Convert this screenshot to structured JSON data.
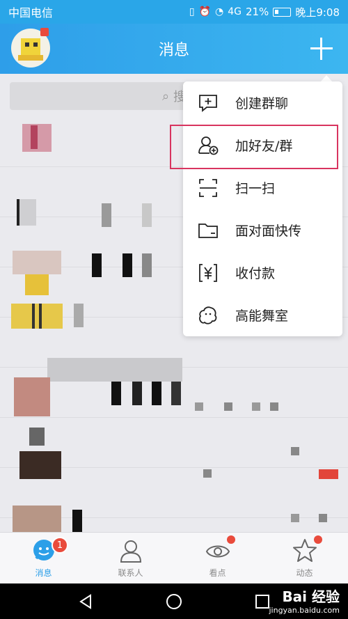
{
  "status_bar": {
    "carrier": "中国电信",
    "signal": "4G",
    "battery": "21%",
    "time": "晚上9:08"
  },
  "header": {
    "title": "消息"
  },
  "search": {
    "placeholder": "搜"
  },
  "menu": {
    "items": [
      {
        "label": "创建群聊",
        "icon": "create-group-chat-icon"
      },
      {
        "label": "加好友/群",
        "icon": "add-friend-icon",
        "highlighted": true
      },
      {
        "label": "扫一扫",
        "icon": "scan-icon"
      },
      {
        "label": "面对面快传",
        "icon": "folder-transfer-icon"
      },
      {
        "label": "收付款",
        "icon": "payment-icon"
      },
      {
        "label": "高能舞室",
        "icon": "ghost-dance-icon"
      }
    ]
  },
  "tabs": [
    {
      "label": "消息",
      "icon": "message-bubble-icon",
      "active": true,
      "badge": "1"
    },
    {
      "label": "联系人",
      "icon": "contacts-icon",
      "active": false
    },
    {
      "label": "看点",
      "icon": "eye-icon",
      "active": false,
      "dot": true
    },
    {
      "label": "动态",
      "icon": "star-icon",
      "active": false,
      "dot": true
    }
  ],
  "watermark": {
    "main": "Bai 经验",
    "sub": "jingyan.baidu.com"
  },
  "colors": {
    "accent": "#2c9fe8",
    "badge": "#e94b3c",
    "highlight_border": "#d8345f"
  }
}
